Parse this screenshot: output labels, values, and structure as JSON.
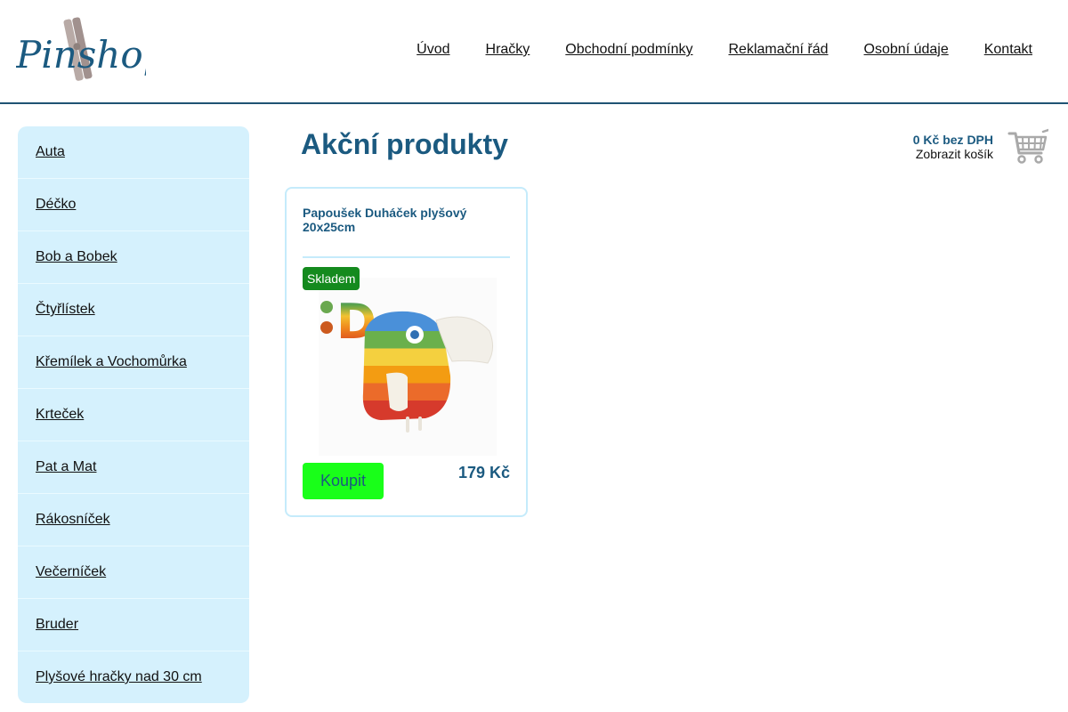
{
  "header": {
    "logo_text": "Pinshop",
    "nav": [
      {
        "label": "Úvod"
      },
      {
        "label": "Hračky"
      },
      {
        "label": "Obchodní podmínky"
      },
      {
        "label": "Reklamační řád"
      },
      {
        "label": "Osobní údaje"
      },
      {
        "label": "Kontakt"
      }
    ]
  },
  "sidebar": {
    "items": [
      {
        "label": "Auta"
      },
      {
        "label": "Déčko"
      },
      {
        "label": "Bob a Bobek"
      },
      {
        "label": "Čtyřlístek"
      },
      {
        "label": "Křemílek a Vochomůrka"
      },
      {
        "label": "Krteček"
      },
      {
        "label": "Pat a Mat"
      },
      {
        "label": "Rákosníček"
      },
      {
        "label": "Večerníček"
      },
      {
        "label": "Bruder"
      },
      {
        "label": "Plyšové hračky nad 30 cm"
      }
    ]
  },
  "main": {
    "title": "Akční produkty"
  },
  "cart": {
    "price": "0 Kč bez DPH",
    "show_label": "Zobrazit košík",
    "icon": "shopping-cart-icon"
  },
  "products": [
    {
      "name": "Papoušek Duháček plyšový 20x25cm",
      "stock": "Skladem",
      "buy_label": "Koupit",
      "price": "179 Kč",
      "image_letter": "D"
    }
  ],
  "colors": {
    "brand": "#1b5a80",
    "sidebar_bg": "#d5f1fd",
    "card_border": "#c5ebfb",
    "buy_button": "#19ff19",
    "stock_badge": "#148a1e"
  }
}
